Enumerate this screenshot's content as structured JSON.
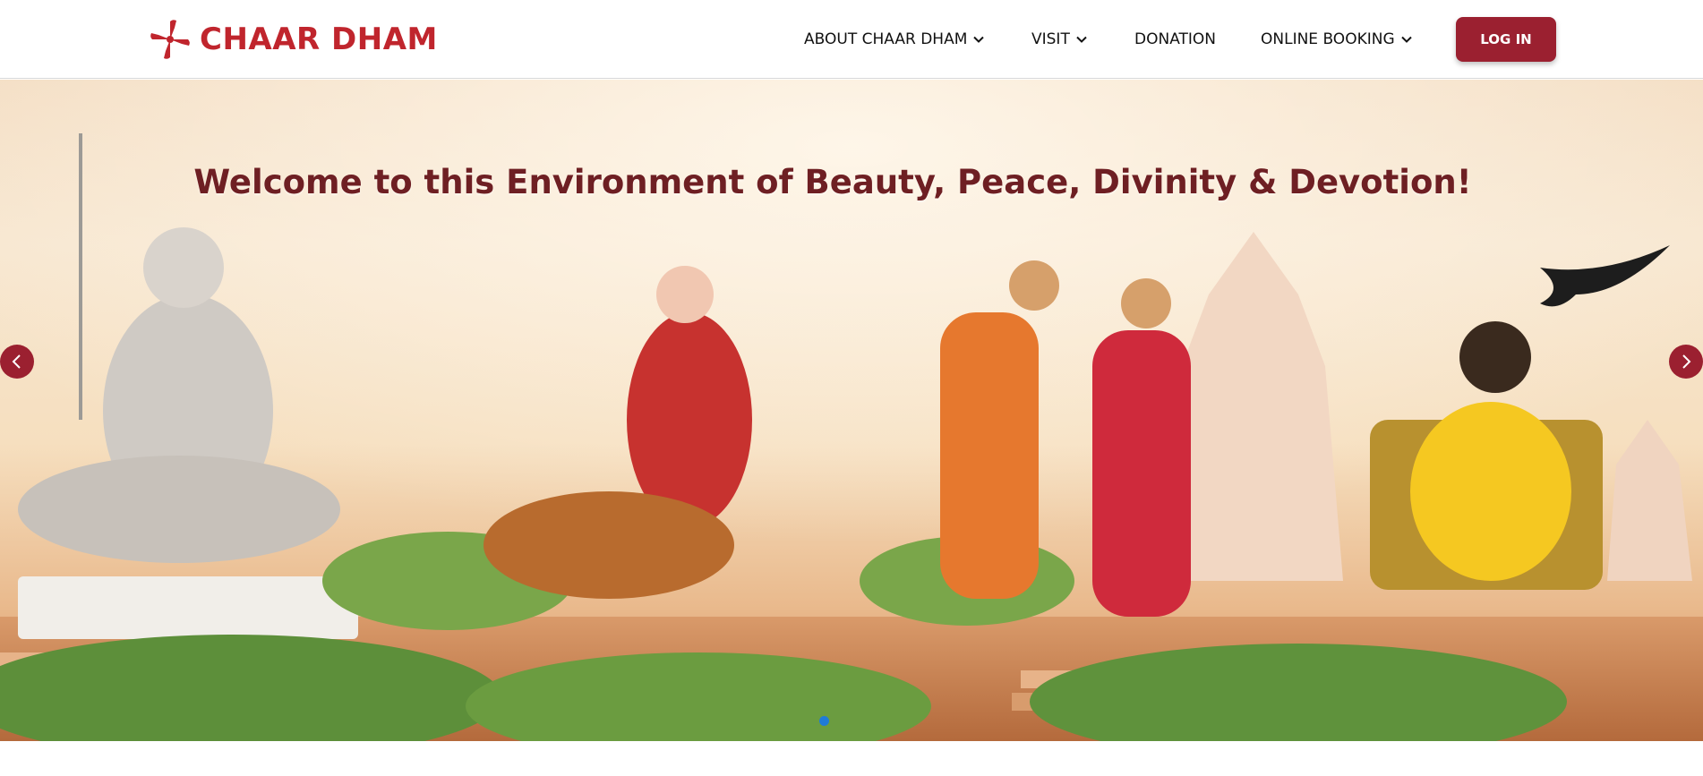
{
  "brand": {
    "name": "CHAAR DHAM",
    "color": "#c0252d",
    "icon": "swastika-logo-icon"
  },
  "nav": {
    "items": [
      {
        "label": "ABOUT CHAAR DHAM",
        "has_dropdown": true
      },
      {
        "label": "VISIT",
        "has_dropdown": true
      },
      {
        "label": "DONATION",
        "has_dropdown": false
      },
      {
        "label": "ONLINE BOOKING",
        "has_dropdown": true
      }
    ],
    "login_label": "LOG IN",
    "login_color": "#9b2030"
  },
  "hero": {
    "title": "Welcome to this Environment of Beauty, Peace, Divinity & Devotion!",
    "title_color": "#6e1f23",
    "prev_icon": "chevron-left-icon",
    "next_icon": "chevron-right-icon",
    "slide_count": 1,
    "active_slide": 1,
    "dot_active_color": "#1f7bd8"
  }
}
